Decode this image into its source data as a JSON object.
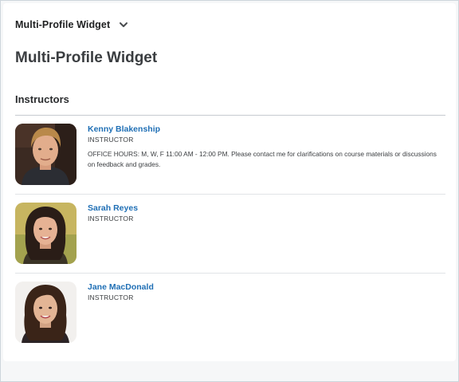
{
  "widget": {
    "menu_title": "Multi-Profile Widget",
    "page_title": "Multi-Profile Widget"
  },
  "section": {
    "title": "Instructors"
  },
  "profiles": [
    {
      "name": "Kenny Blakenship",
      "role": "INSTRUCTOR",
      "description": "OFFICE HOURS: M, W, F 11:00 AM - 12:00 PM. Please contact me for clarifications on course materials or discussions on feedback and grades."
    },
    {
      "name": "Sarah Reyes",
      "role": "INSTRUCTOR",
      "description": ""
    },
    {
      "name": "Jane MacDonald",
      "role": "INSTRUCTOR",
      "description": ""
    }
  ],
  "colors": {
    "link": "#1f6fb5",
    "heading": "#3a3d40",
    "divider": "#c6cbd0"
  }
}
